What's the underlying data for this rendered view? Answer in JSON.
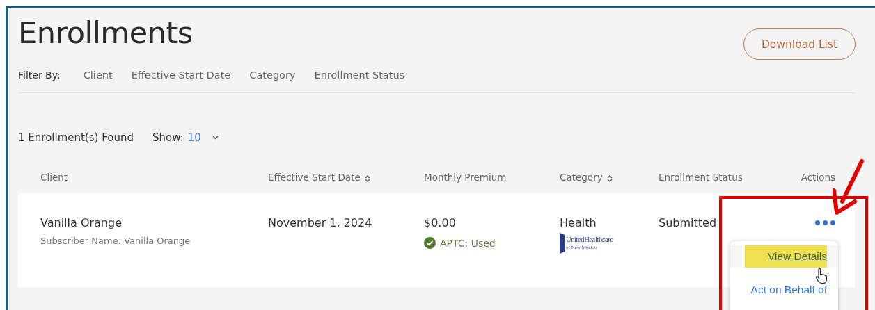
{
  "page": {
    "title": "Enrollments",
    "download_button": "Download List"
  },
  "filters": {
    "label": "Filter By:",
    "items": [
      "Client",
      "Effective Start Date",
      "Category",
      "Enrollment Status"
    ]
  },
  "results": {
    "count": "1 Enrollment(s) Found",
    "show_label": "Show:",
    "show_value": "10"
  },
  "table": {
    "columns": [
      {
        "label": "Client",
        "sortable": false
      },
      {
        "label": "Effective Start Date",
        "sortable": true
      },
      {
        "label": "Monthly Premium",
        "sortable": false
      },
      {
        "label": "Category",
        "sortable": true
      },
      {
        "label": "Enrollment Status",
        "sortable": false
      },
      {
        "label": "Actions",
        "sortable": false
      }
    ],
    "rows": [
      {
        "client": "Vanilla Orange",
        "subscriber": "Subscriber Name: Vanilla Orange",
        "start_date": "November 1, 2024",
        "premium": "$0.00",
        "aptc": "APTC: Used",
        "aptc_used": true,
        "category": "Health",
        "carrier_logo": {
          "name": "UnitedHealthcare",
          "region": "of New Mexico"
        },
        "status": "Submitted",
        "menu_open": true,
        "menu": [
          {
            "label": "View Details",
            "highlighted": true
          },
          {
            "label": "Act on Behalf of",
            "highlighted": false
          }
        ]
      }
    ]
  },
  "annotation": {
    "shown": true
  }
}
